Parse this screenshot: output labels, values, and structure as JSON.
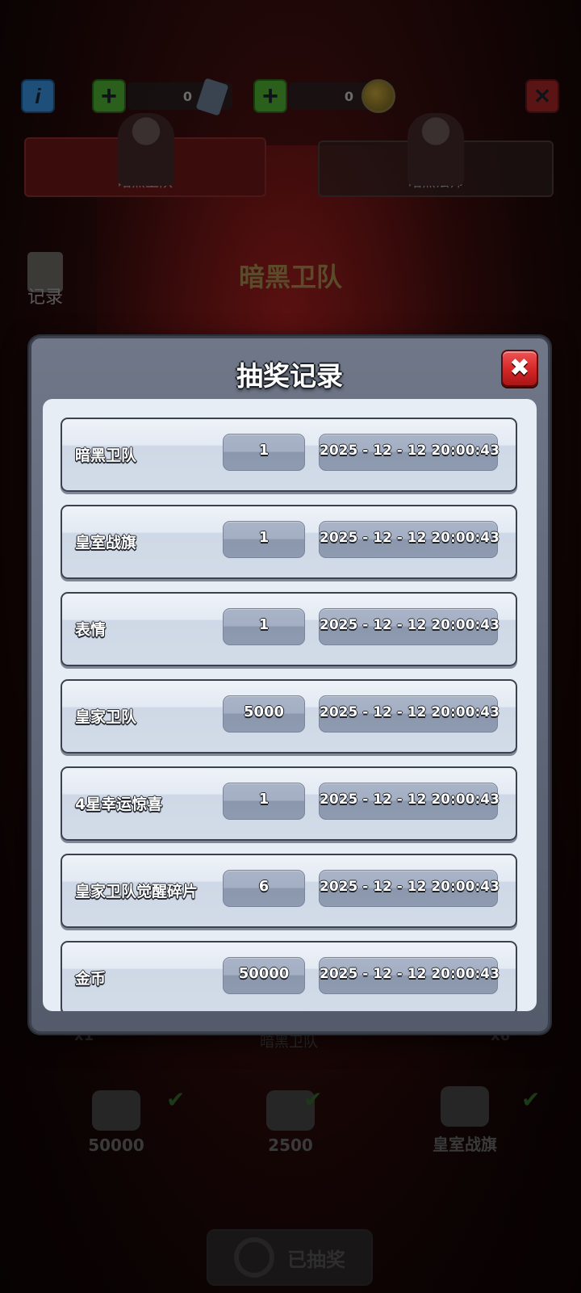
{
  "background": {
    "info_glyph": "i",
    "plus_glyph": "+",
    "close_glyph": "✕",
    "ticket_count": "0",
    "coin_count": "0",
    "tabs": [
      {
        "label": "暗黑卫队"
      },
      {
        "label": "暗黑法师"
      }
    ],
    "record_label": "记录",
    "title": "暗黑卫队",
    "bottom_left_multiplier": "x1",
    "bottom_right_multiplier": "x6",
    "bottom_center_name": "暗黑卫队",
    "rewards": [
      {
        "label": "50000"
      },
      {
        "label": "2500"
      },
      {
        "label": "皇室战旗"
      }
    ],
    "check_glyph": "✔",
    "dismiss_label": "已抽奖"
  },
  "modal": {
    "title": "抽奖记录",
    "close_glyph": "✖",
    "records": [
      {
        "name": "暗黑卫队",
        "count": "1",
        "time": "2025 - 12 - 12  20:00:43"
      },
      {
        "name": "皇室战旗",
        "count": "1",
        "time": "2025 - 12 - 12  20:00:43"
      },
      {
        "name": "表情",
        "count": "1",
        "time": "2025 - 12 - 12  20:00:43"
      },
      {
        "name": "皇家卫队",
        "count": "5000",
        "time": "2025 - 12 - 12  20:00:43"
      },
      {
        "name": "4星幸运惊喜",
        "count": "1",
        "time": "2025 - 12 - 12  20:00:43"
      },
      {
        "name": "皇家卫队觉醒碎片",
        "count": "6",
        "time": "2025 - 12 - 12  20:00:43"
      },
      {
        "name": "金币",
        "count": "50000",
        "time": "2025 - 12 - 12  20:00:43"
      }
    ]
  },
  "colors": {
    "modal_frame": "#5d6576",
    "modal_content": "#e6edf5",
    "close_button": "#d42626",
    "pill": "#a3aec3"
  }
}
